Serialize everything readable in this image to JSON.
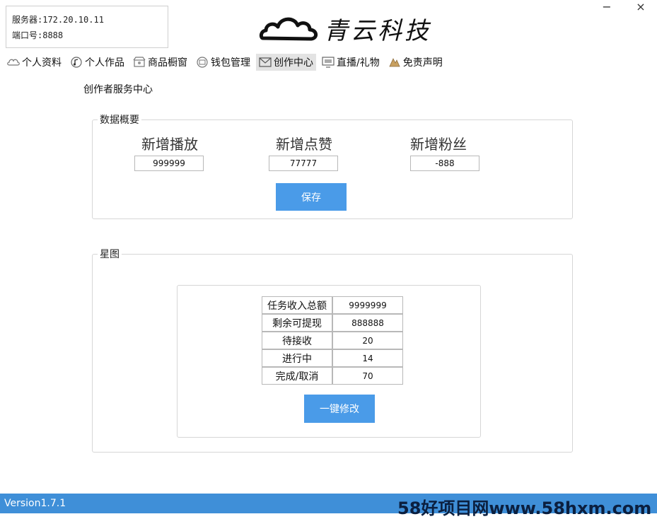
{
  "server": {
    "address_label": "服务器:",
    "address": "172.20.10.11",
    "port_label": "端口号:",
    "port": "8888"
  },
  "brand": {
    "name": "青云科技"
  },
  "window": {
    "minimize": "−",
    "close": "×"
  },
  "tabs": [
    {
      "label": "个人资料",
      "icon": "cloud-icon"
    },
    {
      "label": "个人作品",
      "icon": "music-note-icon"
    },
    {
      "label": "商品橱窗",
      "icon": "shop-icon"
    },
    {
      "label": "钱包管理",
      "icon": "wallet-icon"
    },
    {
      "label": "创作中心",
      "icon": "mail-icon",
      "active": true
    },
    {
      "label": "直播/礼物",
      "icon": "monitor-icon"
    },
    {
      "label": "免责声明",
      "icon": "gift-icon"
    }
  ],
  "page": {
    "heading": "创作者服务中心"
  },
  "overview": {
    "title": "数据概要",
    "metrics": [
      {
        "label": "新增播放",
        "value": "999999"
      },
      {
        "label": "新增点赞",
        "value": "77777"
      },
      {
        "label": "新增粉丝",
        "value": "-888"
      }
    ],
    "save_label": "保存"
  },
  "star": {
    "title": "星图",
    "rows": [
      {
        "key": "任务收入总额",
        "value": "9999999"
      },
      {
        "key": "剩余可提现",
        "value": "888888"
      },
      {
        "key": "待接收",
        "value": "20"
      },
      {
        "key": "进行中",
        "value": "14"
      },
      {
        "key": "完成/取消",
        "value": "70"
      }
    ],
    "modify_label": "一键修改"
  },
  "footer": {
    "version": "Version1.7.1",
    "watermark": "58好项目网www.58hxm.com"
  },
  "colors": {
    "accent": "#4a9be8",
    "footer": "#3f8fd8"
  }
}
